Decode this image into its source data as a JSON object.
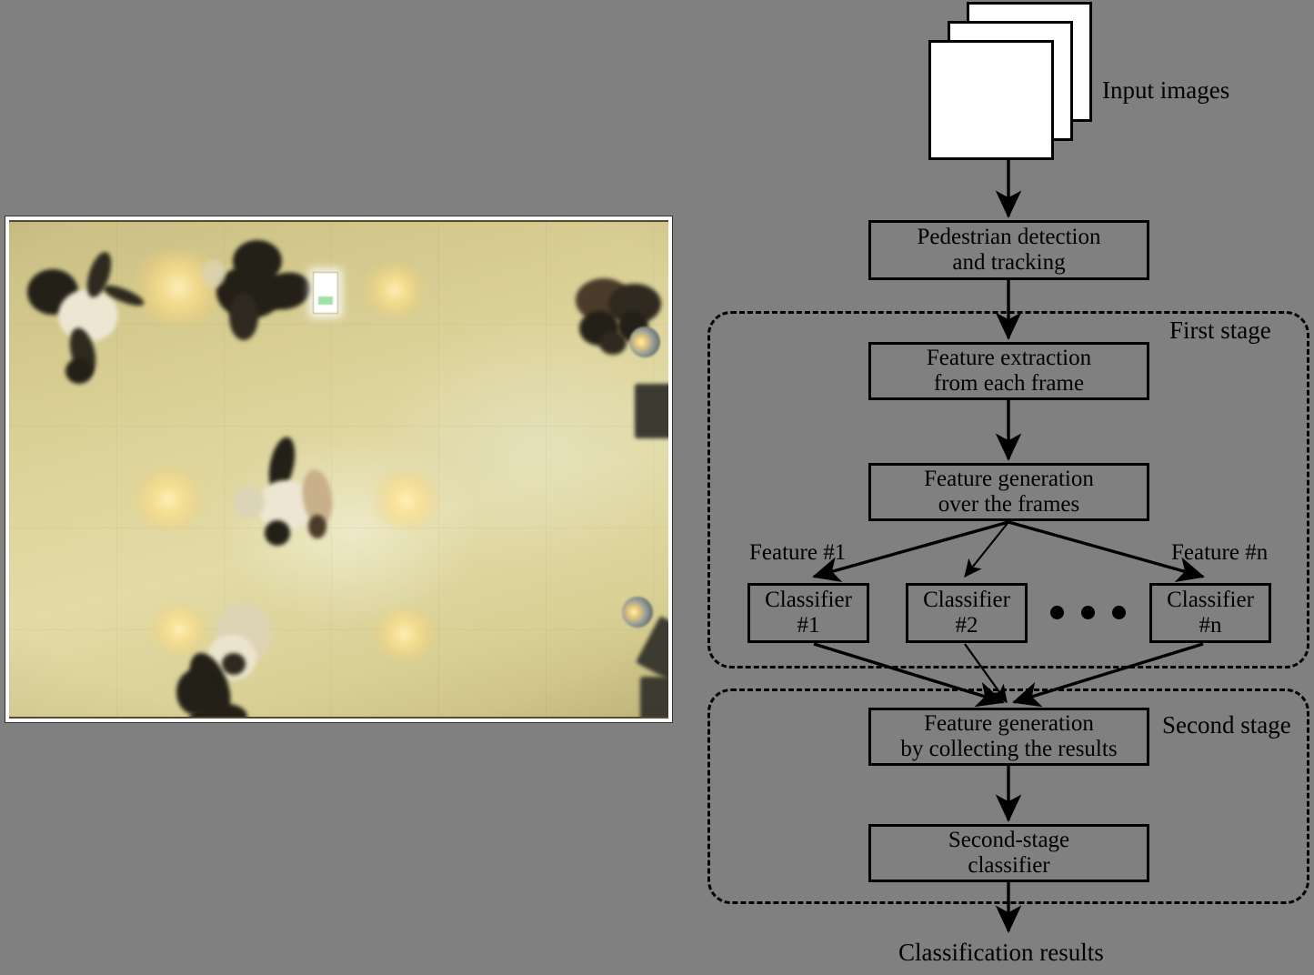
{
  "figure": {
    "background_color": "#808080",
    "title_none": ""
  },
  "photo": {
    "caption": "",
    "description": "overhead surveillance view of a tiled floor with pedestrians",
    "border_color": "#ffffff"
  },
  "flow": {
    "input_label": "Input images",
    "nodes": {
      "pedestrian": "Pedestrian detection\nand tracking",
      "feature_extraction": "Feature extraction\nfrom each frame",
      "feature_generation": "Feature generation\nover the frames",
      "classifier_1": "Classifier\n#1",
      "classifier_2": "Classifier\n#2",
      "classifier_n": "Classifier\n#n",
      "collect": "Feature generation\nby collecting the results",
      "second_classifier": "Second-stage\nclassifier"
    },
    "edge_labels": {
      "feature_first": "Feature #1",
      "feature_n": "Feature #n"
    },
    "stage_labels": {
      "first": "First stage",
      "second": "Second stage"
    },
    "output_label": "Classification results",
    "ellipsis": "• • •"
  }
}
